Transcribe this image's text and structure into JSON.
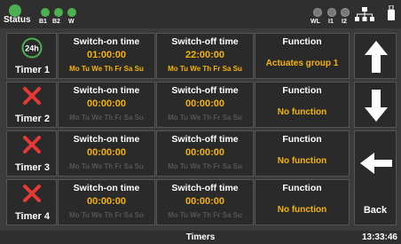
{
  "status": {
    "label": "Status",
    "leds": [
      "B1",
      "B2",
      "W"
    ],
    "indicators": [
      "WL",
      "I1",
      "I2"
    ]
  },
  "colors": {
    "accent": "#f5b400",
    "ok": "#4caf50",
    "error": "#e53935"
  },
  "headers": {
    "on": "Switch-on time",
    "off": "Switch-off time",
    "function": "Function"
  },
  "days": [
    "Mo",
    "Tu",
    "We",
    "Th",
    "Fr",
    "Sa",
    "Su"
  ],
  "timers": [
    {
      "name": "Timer 1",
      "icon": "timer-24h-icon",
      "on_time": "01:00:00",
      "off_time": "22:00:00",
      "function": "Actuates group 1",
      "active": true
    },
    {
      "name": "Timer 2",
      "icon": "disabled-x-icon",
      "on_time": "00:00:00",
      "off_time": "00:00:00",
      "function": "No function",
      "active": false
    },
    {
      "name": "Timer 3",
      "icon": "disabled-x-icon",
      "on_time": "00:00:00",
      "off_time": "00:00:00",
      "function": "No function",
      "active": false
    },
    {
      "name": "Timer 4",
      "icon": "disabled-x-icon",
      "on_time": "00:00:00",
      "off_time": "00:00:00",
      "function": "No function",
      "active": false
    }
  ],
  "nav": {
    "up_icon": "arrow-up-icon",
    "down_icon": "arrow-down-icon",
    "back_icon": "arrow-left-icon",
    "back_label": "Back"
  },
  "footer": {
    "title": "Timers",
    "clock": "13:33:46"
  }
}
